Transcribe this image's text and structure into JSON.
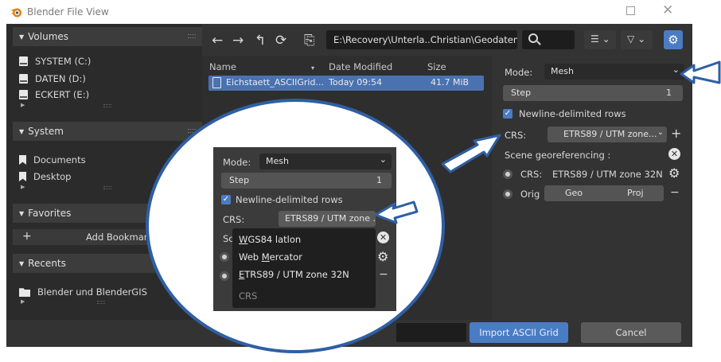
{
  "window": {
    "title": "Blender File View"
  },
  "sidebar": {
    "volumes": {
      "header": "Volumes",
      "items": [
        "SYSTEM (C:)",
        "DATEN (D:)",
        "ECKERT (E:)"
      ]
    },
    "system": {
      "header": "System",
      "items": [
        "Documents",
        "Desktop"
      ]
    },
    "favorites": {
      "header": "Favorites",
      "add_icon": "+",
      "add_label": "Add Bookmark"
    },
    "recents": {
      "header": "Recents",
      "items": [
        "Blender und BlenderGIS"
      ]
    }
  },
  "toolbar": {
    "back_icon": "←",
    "forward_icon": "→",
    "parent_icon": "↰",
    "refresh_icon": "⟳",
    "new_folder_icon": "⎘",
    "path": "E:\\Recovery\\Unterla..Christian\\Geodaten\\",
    "search_value": "",
    "display_mode_icon": "☰",
    "filter_icon": "▽",
    "chevron": "⌄",
    "settings_icon": "⚙"
  },
  "filelist": {
    "columns": [
      "Name",
      "Date Modified",
      "Size"
    ],
    "sort_indicator": "▾",
    "rows": [
      {
        "name": "Eichstaett_ASCIIGrid...",
        "date": "Today 09:54",
        "size": "41.7 MiB",
        "selected": true
      }
    ]
  },
  "options": {
    "mode_label": "Mode:",
    "mode_value": "Mesh",
    "step_label": "Step",
    "step_value": "1",
    "newline_label": "Newline-delimited rows",
    "newline_checked": true,
    "crs_label": "CRS:",
    "crs_value": "ETRS89 / UTM zone...",
    "crs_add": "+",
    "scene_geo_label": "Scene georeferencing :",
    "scene_crs_label": "CRS:",
    "scene_crs_value": "ETRS89 / UTM zone 32N",
    "origin_label": "Orig",
    "origin_geo": "Geo",
    "origin_proj": "Proj",
    "minus": "−"
  },
  "footer": {
    "filename_value": "",
    "import_label": "Import ASCII Grid",
    "cancel_label": "Cancel"
  },
  "zoom": {
    "mode_label": "Mode:",
    "mode_value": "Mesh",
    "step_label": "Step",
    "step_value": "1",
    "newline_label": "Newline-delimited rows",
    "crs_label": "CRS:",
    "crs_value": "ETRS89 / UTM zone ...",
    "partial_label": "Sc",
    "minus": "−",
    "popup_items": [
      {
        "text": "WGS84 latlon",
        "underline_char": "W"
      },
      {
        "text": "Web Mercator",
        "underline_char": "M"
      },
      {
        "text": "ETRS89 / UTM zone 32N",
        "underline_char": "E"
      }
    ],
    "popup_footer": "CRS"
  },
  "colors": {
    "accent": "#4a7cc4",
    "annotation_blue": "#2f5fa4",
    "panel_bg": "#333333",
    "sidebar_bg": "#2b2b2b"
  }
}
